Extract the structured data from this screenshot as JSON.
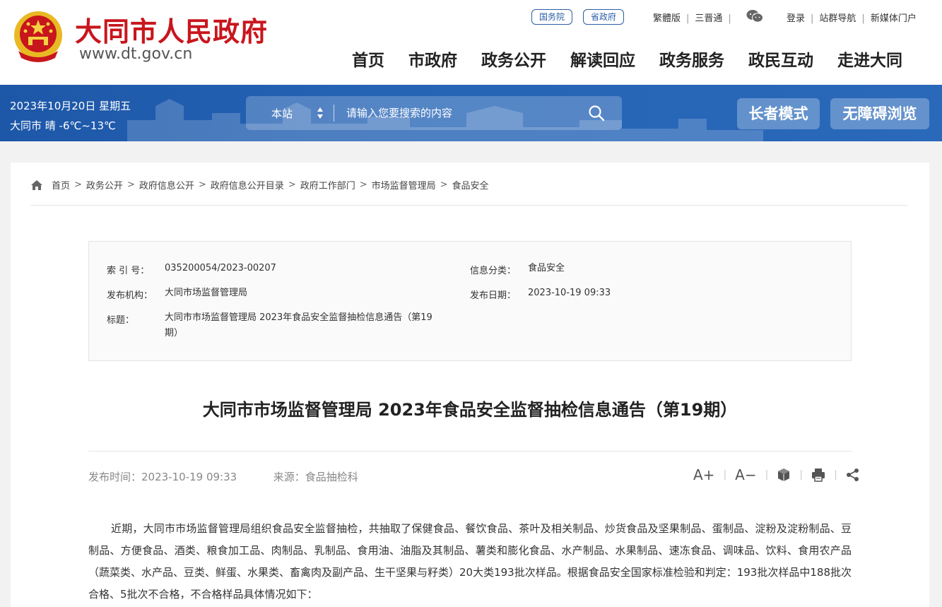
{
  "header": {
    "site_title": "大同市人民政府",
    "site_url": "www.dt.gov.cn",
    "pills": [
      "国务院",
      "省政府"
    ],
    "toplinks_left": [
      "繁體版",
      "三晋通"
    ],
    "toplinks_right": [
      "登录",
      "站群导航",
      "新媒体门户"
    ],
    "nav": [
      "首页",
      "市政府",
      "政务公开",
      "解读回应",
      "政务服务",
      "政民互动",
      "走进大同"
    ],
    "colors": {
      "brand_red": "#c8161d",
      "brand_blue": "#1d57a8"
    }
  },
  "banner": {
    "date": "2023年10月20日 星期五",
    "weather": "大同市 晴 -6℃~13℃",
    "search_scope": "本站",
    "search_placeholder": "请输入您要搜索的内容",
    "elder_mode": "长者模式",
    "accessible": "无障碍浏览"
  },
  "breadcrumb": [
    "首页",
    "政务公开",
    "政府信息公开",
    "政府信息公开目录",
    "政府工作部门",
    "市场监督管理局",
    "食品安全"
  ],
  "meta": {
    "index_label": "索 引 号：",
    "index_value": "035200054/2023-00207",
    "category_label": "信息分类：",
    "category_value": "食品安全",
    "org_label": "发布机构：",
    "org_value": "大同市场监督管理局",
    "date_label": "发布日期：",
    "date_value": "2023-10-19 09:33",
    "title_label": "标题：",
    "title_value": "大同市市场监督管理局 2023年食品安全监督抽检信息通告（第19期）"
  },
  "article": {
    "title": "大同市市场监督管理局 2023年食品安全监督抽检信息通告（第19期）",
    "publish_time": "发布时间：2023-10-19 09:33",
    "source": "来源：食品抽检科",
    "font_increase": "A+",
    "font_decrease": "A−",
    "body": "近期，大同市市场监督管理局组织食品安全监督抽检，共抽取了保健食品、餐饮食品、茶叶及相关制品、炒货食品及坚果制品、蛋制品、淀粉及淀粉制品、豆制品、方便食品、酒类、粮食加工品、肉制品、乳制品、食用油、油脂及其制品、薯类和膨化食品、水产制品、水果制品、速冻食品、调味品、饮料、食用农产品（蔬菜类、水产品、豆类、鲜蛋、水果类、畜禽肉及副产品、生干坚果与籽类）20大类193批次样品。根据食品安全国家标准检验和判定：193批次样品中188批次合格、5批次不合格，不合格样品具体情况如下："
  }
}
